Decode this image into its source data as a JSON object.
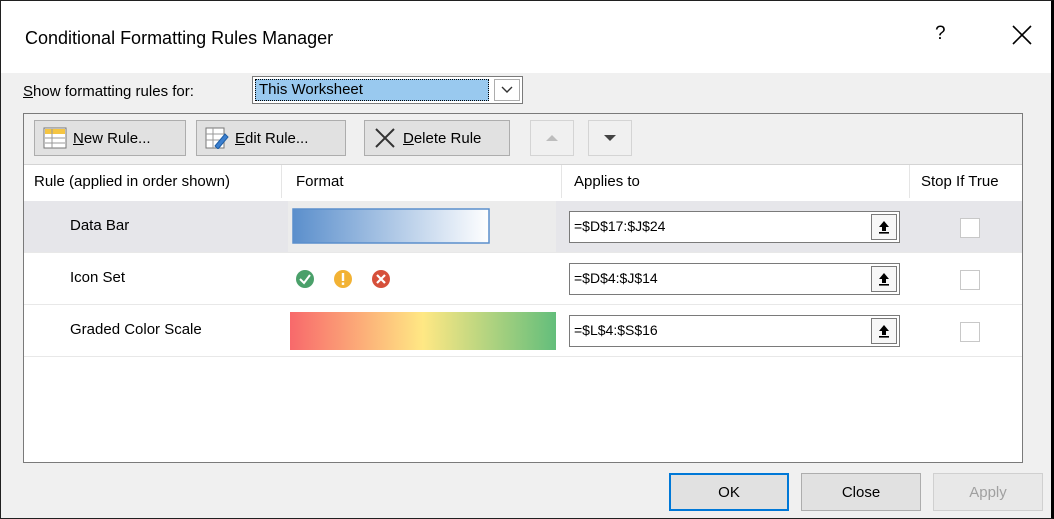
{
  "dialog": {
    "title": "Conditional Formatting Rules Manager",
    "help_label": "?"
  },
  "show_rules": {
    "label_prefix": "S",
    "label_rest": "how formatting rules for:",
    "selected": "This Worksheet"
  },
  "toolbar": {
    "new_rule": {
      "mnemonic": "N",
      "rest": "ew Rule..."
    },
    "edit_rule": {
      "mnemonic": "E",
      "rest": "dit Rule..."
    },
    "delete_rule": {
      "mnemonic": "D",
      "rest": "elete Rule"
    }
  },
  "columns": {
    "rule": "Rule (applied in order shown)",
    "format": "Format",
    "applies_to": "Applies to",
    "stop_if_true": "Stop If True"
  },
  "rules": [
    {
      "name": "Data Bar",
      "applies_to": "=$D$17:$J$24",
      "stop_if_true": false,
      "selected": true,
      "format_kind": "data-bar"
    },
    {
      "name": "Icon Set",
      "applies_to": "=$D$4:$J$14",
      "stop_if_true": false,
      "selected": false,
      "format_kind": "icon-set",
      "icons": [
        "check-circle-icon",
        "exclamation-circle-icon",
        "x-circle-icon"
      ]
    },
    {
      "name": "Graded Color Scale",
      "applies_to": "=$L$4:$S$16",
      "stop_if_true": false,
      "selected": false,
      "format_kind": "color-scale"
    }
  ],
  "buttons": {
    "ok": "OK",
    "close": "Close",
    "apply": "Apply"
  },
  "colors": {
    "selection_highlight": "#99c9ef",
    "data_bar": "#5b8fcc",
    "icon_green": "#4aa06a",
    "icon_yellow": "#f2b234",
    "icon_red": "#d6503a",
    "scale_low": "#f8696b",
    "scale_mid": "#ffe884",
    "scale_high": "#63be7b",
    "ok_focus": "#0078d7"
  }
}
